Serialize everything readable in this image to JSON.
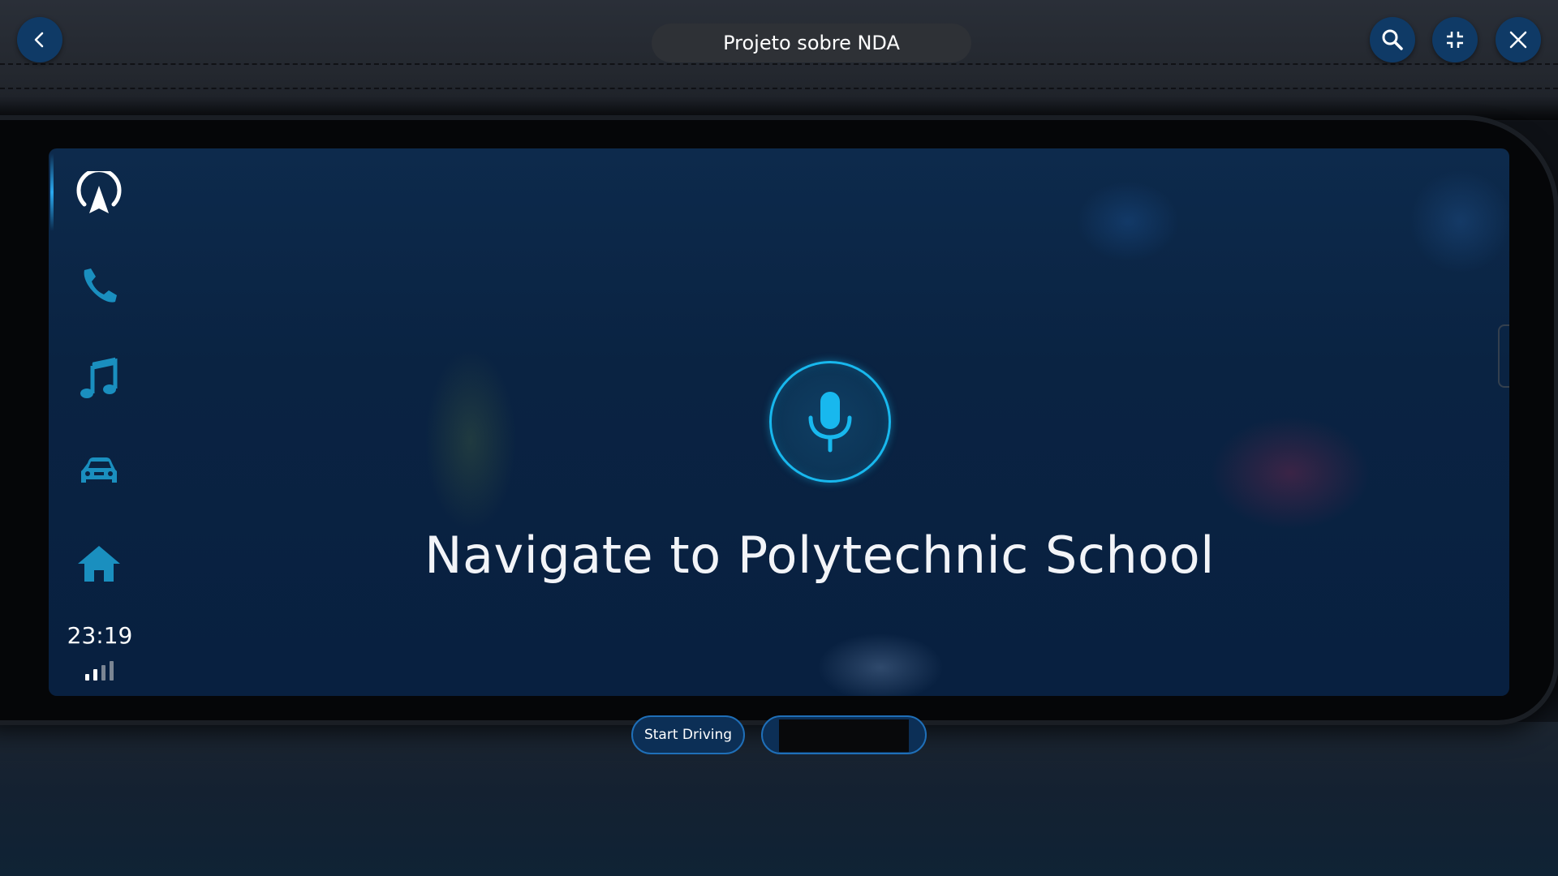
{
  "window": {
    "title": "Projeto sobre NDA",
    "back_icon": "chevron-left-icon",
    "search_icon": "search-icon",
    "collapse_icon": "collapse-icon",
    "close_icon": "close-icon"
  },
  "sidebar": {
    "items": [
      {
        "id": "navigation",
        "icon": "navigation-arrow-icon",
        "active": true
      },
      {
        "id": "phone",
        "icon": "phone-icon",
        "active": false
      },
      {
        "id": "music",
        "icon": "music-note-icon",
        "active": false
      },
      {
        "id": "vehicle",
        "icon": "car-icon",
        "active": false
      },
      {
        "id": "home",
        "icon": "home-icon",
        "active": false
      }
    ],
    "clock": "23:19",
    "signal_bars_lit": 2,
    "signal_bars_total": 4
  },
  "assistant": {
    "mic_icon": "microphone-icon",
    "prompt": "Navigate to Polytechnic School"
  },
  "controls": {
    "start_driving_label": "Start Driving",
    "second_button_label": ""
  },
  "colors": {
    "accent": "#18b8ee",
    "icon_teal": "#1a8fbf",
    "button_fill": "#0f3a66",
    "pill_fill": "#2e3136",
    "screen_bg": "#0a2342"
  }
}
